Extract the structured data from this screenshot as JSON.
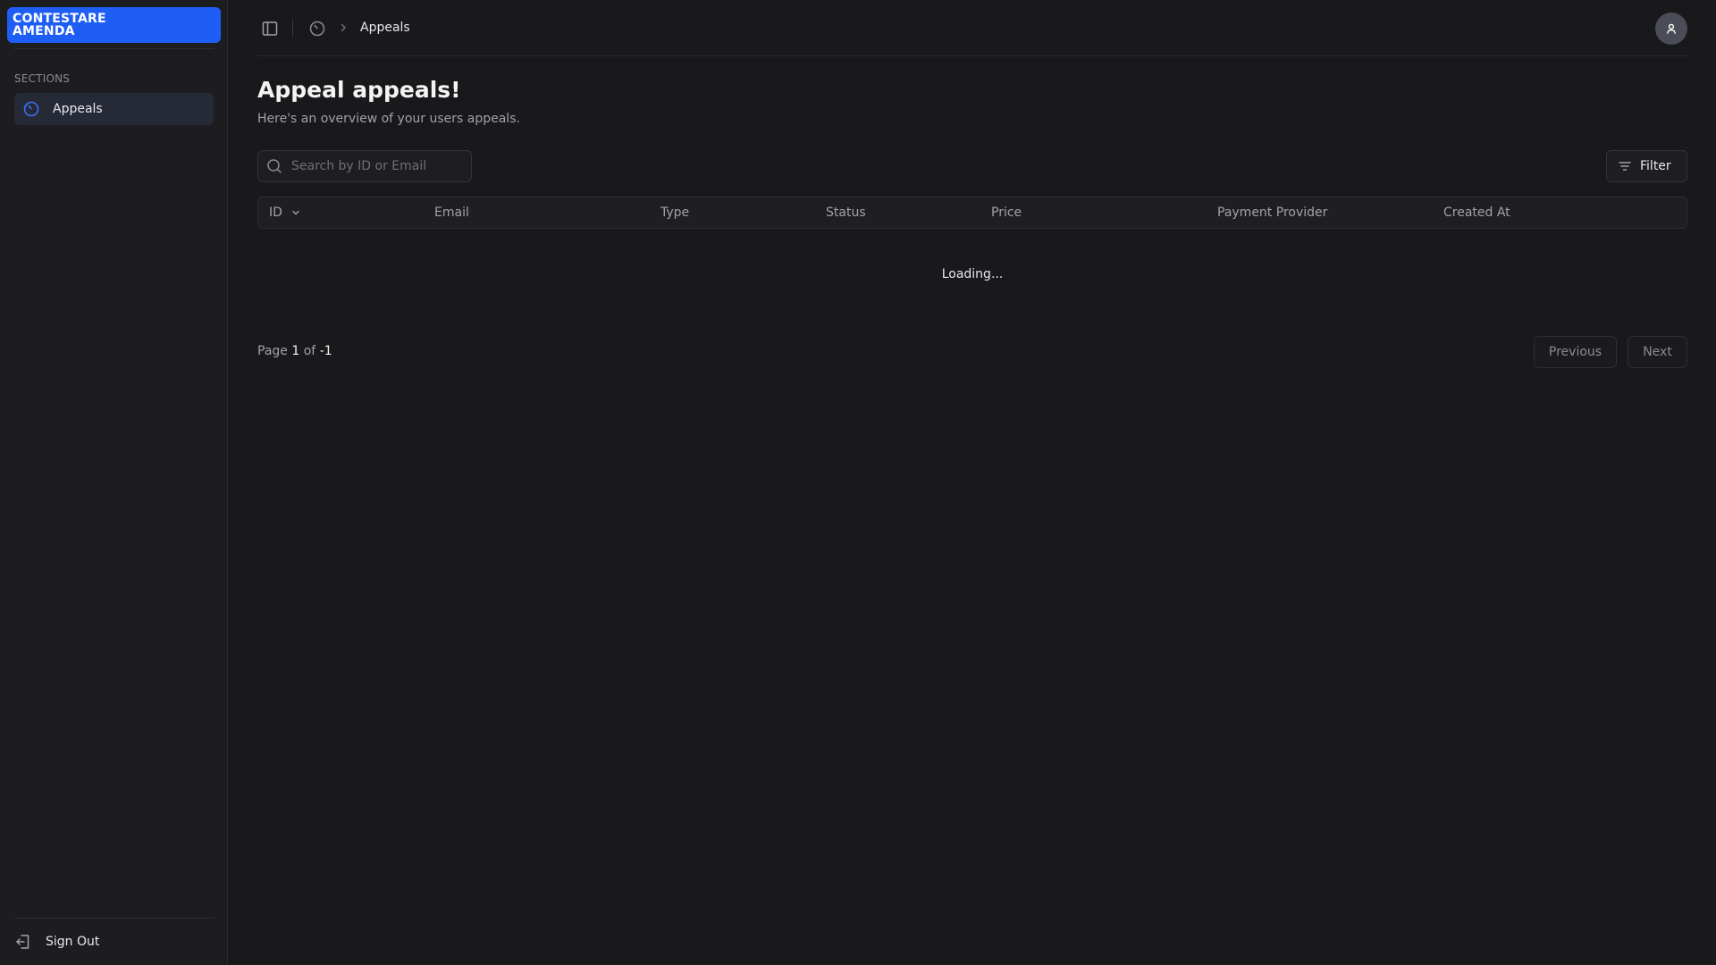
{
  "brand": {
    "line1": "CONTESTARE",
    "line2": "AMENDA",
    "color": "#1f5ef5"
  },
  "sidebar": {
    "section_label": "SECTIONS",
    "items": [
      {
        "label": "Appeals",
        "icon": "timer-off-icon",
        "active": true
      }
    ],
    "sign_out_label": "Sign Out"
  },
  "header": {
    "breadcrumb": {
      "icon": "timer-off-icon",
      "current": "Appeals"
    }
  },
  "main": {
    "title": "Appeal appeals!",
    "subtitle": "Here's an overview of your users appeals.",
    "search": {
      "placeholder": "Search by ID or Email",
      "value": ""
    },
    "filter_label": "Filter",
    "table": {
      "columns": [
        "ID",
        "Email",
        "Type",
        "Status",
        "Price",
        "Payment Provider",
        "Created At"
      ],
      "loading_text": "Loading..."
    },
    "pagination": {
      "page_word": "Page",
      "current_page": "1",
      "of_word": "of",
      "total_pages": "-1",
      "prev_label": "Previous",
      "next_label": "Next"
    }
  }
}
